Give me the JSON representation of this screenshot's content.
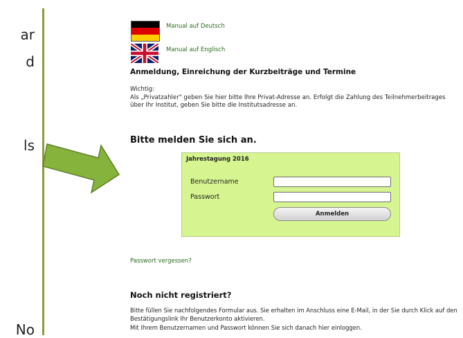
{
  "left_fragments": [
    "ar",
    "d",
    "ls",
    "No"
  ],
  "manuals": {
    "german_label": "Manual auf Deutsch",
    "english_label": "Manual auf Englisch"
  },
  "section_heading": "Anmeldung, Einreichung der Kurzbeiträge und Termine",
  "note": {
    "title": "Wichtig:",
    "text": "Als „Privatzahler\" geben Sie hier bitte Ihre Privat-Adresse an. Erfolgt die Zahlung des Teilnehmerbeitrages über Ihr Institut, geben Sie bitte die Institutsadresse an."
  },
  "login": {
    "heading": "Bitte melden Sie sich an.",
    "box_title": "Jahrestagung 2016",
    "username_label": "Benutzername",
    "password_label": "Passwort",
    "username_value": "",
    "password_value": "",
    "submit_label": "Anmelden"
  },
  "forgot_password": "Passwort vergessen?",
  "register": {
    "heading": "Noch nicht registriert?",
    "paragraph1": "Bitte füllen Sie nachfolgendes Formular aus. Sie erhalten im Anschluss eine E-Mail, in der Sie durch Klick auf den Bestätigungslink Ihr Benutzerkonto aktivieren.",
    "paragraph2": "Mit Ihrem Benutzernamen und Passwort können Sie sich danach hier einloggen."
  },
  "colors": {
    "login_box_bg": "#d6f590",
    "link_green": "#2b6b1e",
    "divider_line": "#8a9b3a",
    "arrow_fill": "#86b33c"
  },
  "icons": [
    "german-flag-icon",
    "uk-flag-icon",
    "pointer-arrow-icon"
  ]
}
